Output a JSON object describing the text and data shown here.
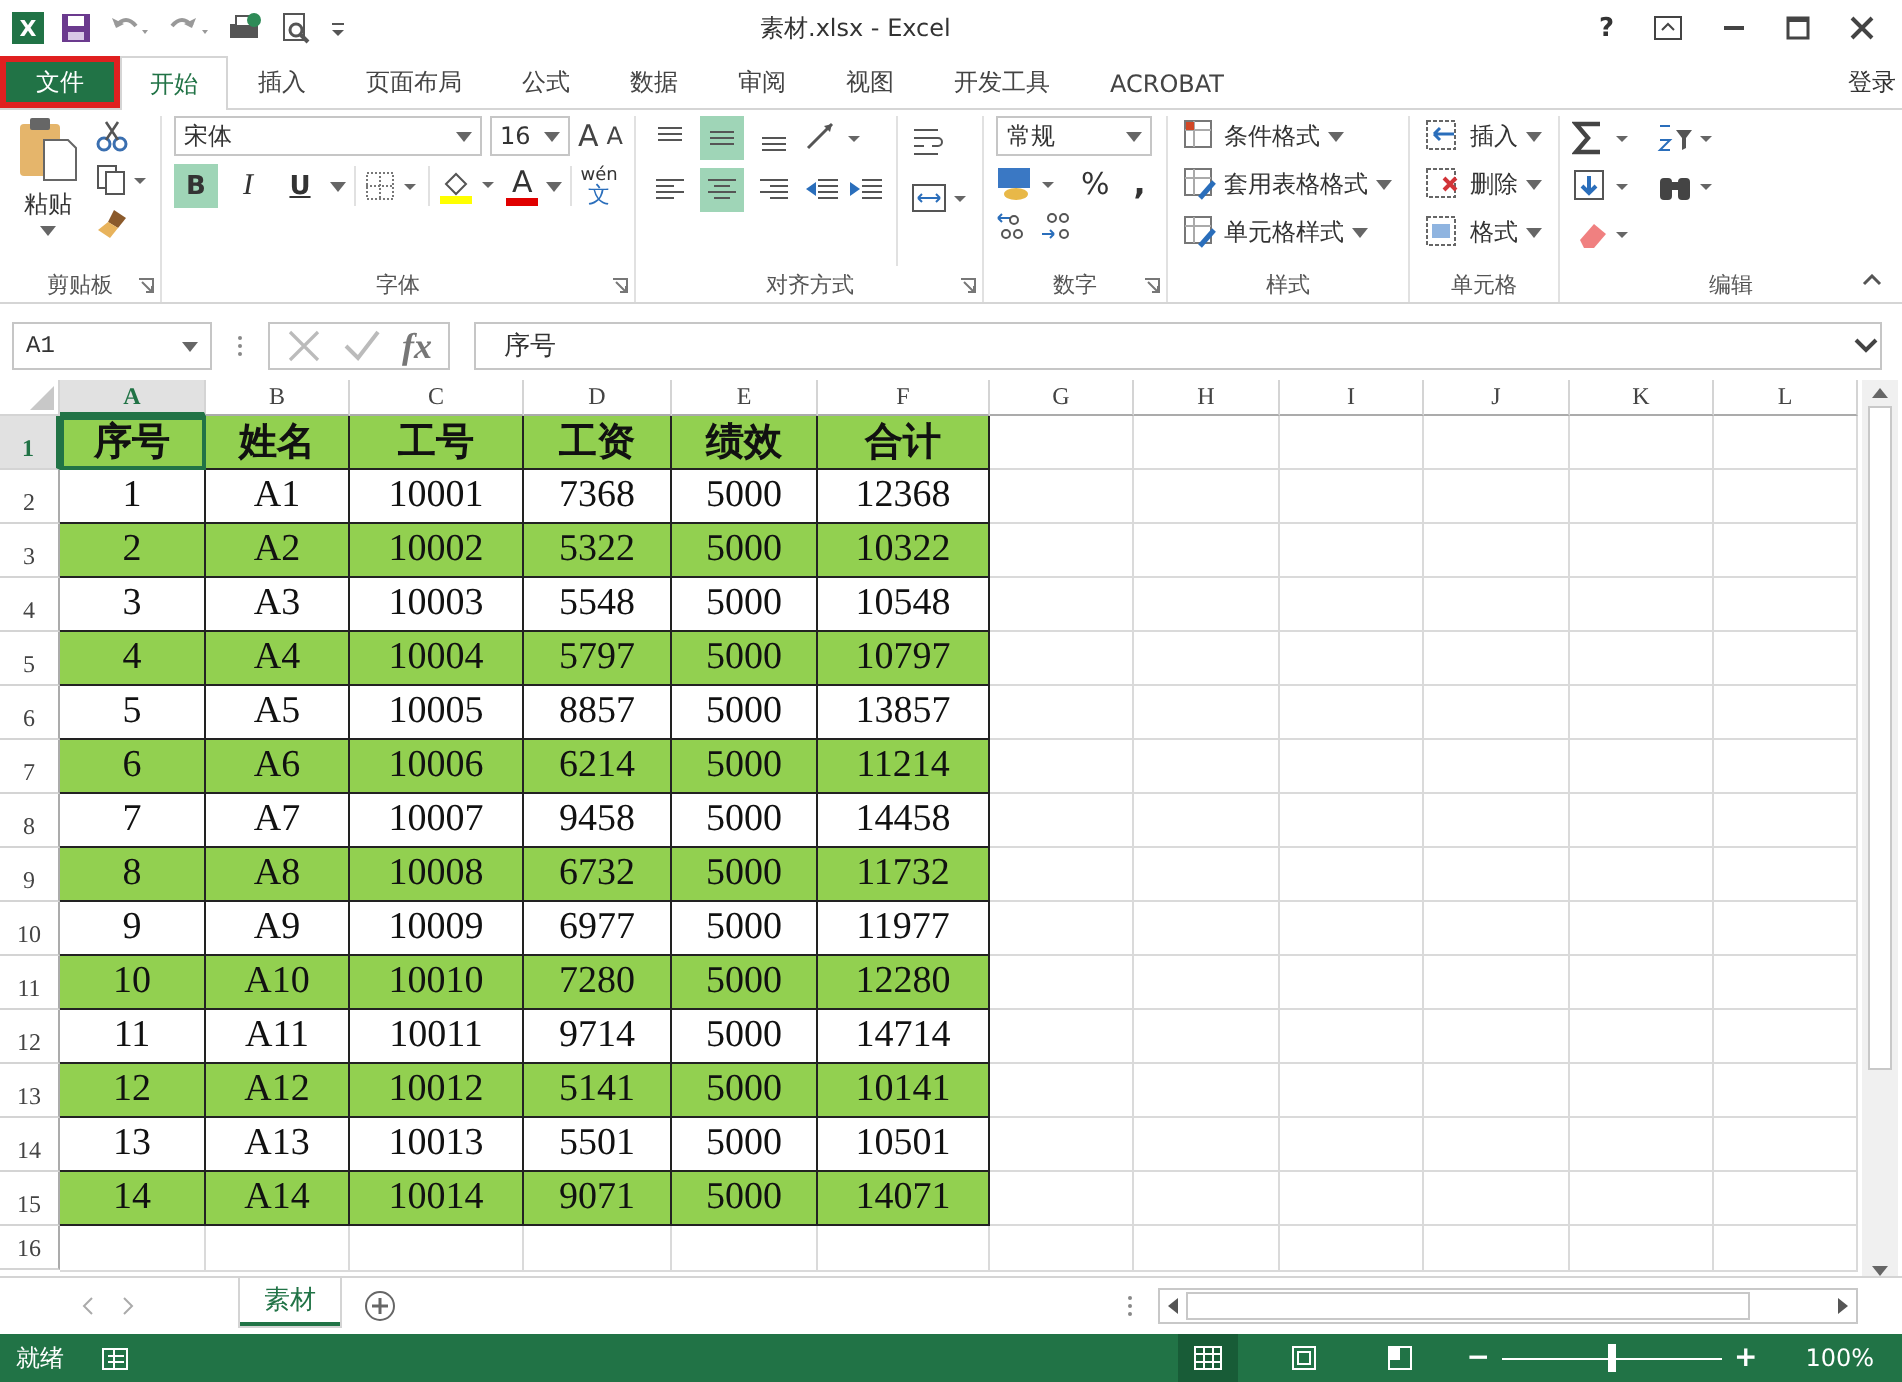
{
  "title_bar": {
    "app_icon": "X",
    "title": "素材.xlsx - Excel",
    "help": "?"
  },
  "menu_tabs": [
    {
      "label": "文件",
      "kind": "file",
      "selected": false,
      "annotated": true
    },
    {
      "label": "开始",
      "kind": "tab",
      "selected": true
    },
    {
      "label": "插入",
      "kind": "tab",
      "selected": false
    },
    {
      "label": "页面布局",
      "kind": "tab",
      "selected": false
    },
    {
      "label": "公式",
      "kind": "tab",
      "selected": false
    },
    {
      "label": "数据",
      "kind": "tab",
      "selected": false
    },
    {
      "label": "审阅",
      "kind": "tab",
      "selected": false
    },
    {
      "label": "视图",
      "kind": "tab",
      "selected": false
    },
    {
      "label": "开发工具",
      "kind": "tab",
      "selected": false
    },
    {
      "label": "ACROBAT",
      "kind": "tab",
      "selected": false
    }
  ],
  "account": "登录",
  "ribbon": {
    "clipboard": {
      "paste": "粘贴",
      "label": "剪贴板"
    },
    "font": {
      "name": "宋体",
      "size": "16",
      "grow": "A",
      "shrink": "A",
      "label": "字体",
      "phonetic_top": "wén",
      "phonetic_bottom": "文",
      "font_color": "A",
      "styles": [
        {
          "text": "B",
          "kind": "bold",
          "on": true
        },
        {
          "text": "I",
          "kind": "italic",
          "on": false
        },
        {
          "text": "U",
          "kind": "underline",
          "on": false
        }
      ]
    },
    "alignment": {
      "label": "对齐方式",
      "vertical": [
        {
          "kind": "top",
          "on": false
        },
        {
          "kind": "middle",
          "on": true
        },
        {
          "kind": "bottom",
          "on": false
        }
      ],
      "horizontal": [
        {
          "kind": "left",
          "on": false
        },
        {
          "kind": "center",
          "on": true
        },
        {
          "kind": "right",
          "on": false
        }
      ]
    },
    "number": {
      "format": "常规",
      "percent": "%",
      "comma": ",",
      "label": "数字"
    },
    "styles": {
      "items": [
        "条件格式",
        "套用表格格式",
        "单元格样式"
      ],
      "label": "样式"
    },
    "cells": {
      "items": [
        "插入",
        "删除",
        "格式"
      ],
      "label": "单元格"
    },
    "editing": {
      "label": "编辑"
    }
  },
  "formula_bar": {
    "name_box": "A1",
    "fx": "fx",
    "value": "序号"
  },
  "sheet": {
    "columns": [
      {
        "label": "A",
        "selected": true
      },
      {
        "label": "B",
        "selected": false
      },
      {
        "label": "C",
        "selected": false
      },
      {
        "label": "D",
        "selected": false
      },
      {
        "label": "E",
        "selected": false
      },
      {
        "label": "F",
        "selected": false
      },
      {
        "label": "G",
        "selected": false
      },
      {
        "label": "H",
        "selected": false
      },
      {
        "label": "I",
        "selected": false
      },
      {
        "label": "J",
        "selected": false
      },
      {
        "label": "K",
        "selected": false
      },
      {
        "label": "L",
        "selected": false
      }
    ],
    "rows": [
      {
        "header": "1",
        "selected": true,
        "kind": "header",
        "shaded": true,
        "cells": [
          "序号",
          "姓名",
          "工号",
          "工资",
          "绩效",
          "合计"
        ]
      },
      {
        "header": "2",
        "selected": false,
        "kind": "data",
        "shaded": false,
        "cells": [
          "1",
          "A1",
          "10001",
          "7368",
          "5000",
          "12368"
        ]
      },
      {
        "header": "3",
        "selected": false,
        "kind": "data",
        "shaded": true,
        "cells": [
          "2",
          "A2",
          "10002",
          "5322",
          "5000",
          "10322"
        ]
      },
      {
        "header": "4",
        "selected": false,
        "kind": "data",
        "shaded": false,
        "cells": [
          "3",
          "A3",
          "10003",
          "5548",
          "5000",
          "10548"
        ]
      },
      {
        "header": "5",
        "selected": false,
        "kind": "data",
        "shaded": true,
        "cells": [
          "4",
          "A4",
          "10004",
          "5797",
          "5000",
          "10797"
        ]
      },
      {
        "header": "6",
        "selected": false,
        "kind": "data",
        "shaded": false,
        "cells": [
          "5",
          "A5",
          "10005",
          "8857",
          "5000",
          "13857"
        ]
      },
      {
        "header": "7",
        "selected": false,
        "kind": "data",
        "shaded": true,
        "cells": [
          "6",
          "A6",
          "10006",
          "6214",
          "5000",
          "11214"
        ]
      },
      {
        "header": "8",
        "selected": false,
        "kind": "data",
        "shaded": false,
        "cells": [
          "7",
          "A7",
          "10007",
          "9458",
          "5000",
          "14458"
        ]
      },
      {
        "header": "9",
        "selected": false,
        "kind": "data",
        "shaded": true,
        "cells": [
          "8",
          "A8",
          "10008",
          "6732",
          "5000",
          "11732"
        ]
      },
      {
        "header": "10",
        "selected": false,
        "kind": "data",
        "shaded": false,
        "cells": [
          "9",
          "A9",
          "10009",
          "6977",
          "5000",
          "11977"
        ]
      },
      {
        "header": "11",
        "selected": false,
        "kind": "data",
        "shaded": true,
        "cells": [
          "10",
          "A10",
          "10010",
          "7280",
          "5000",
          "12280"
        ]
      },
      {
        "header": "12",
        "selected": false,
        "kind": "data",
        "shaded": false,
        "cells": [
          "11",
          "A11",
          "10011",
          "9714",
          "5000",
          "14714"
        ]
      },
      {
        "header": "13",
        "selected": false,
        "kind": "data",
        "shaded": true,
        "cells": [
          "12",
          "A12",
          "10012",
          "5141",
          "5000",
          "10141"
        ]
      },
      {
        "header": "14",
        "selected": false,
        "kind": "data",
        "shaded": false,
        "cells": [
          "13",
          "A13",
          "10013",
          "5501",
          "5000",
          "10501"
        ]
      },
      {
        "header": "15",
        "selected": false,
        "kind": "data",
        "shaded": true,
        "cells": [
          "14",
          "A14",
          "10014",
          "9071",
          "5000",
          "14071"
        ]
      },
      {
        "header": "16",
        "selected": false,
        "cells": []
      }
    ]
  },
  "sheet_tabs": [
    {
      "label": "素材",
      "selected": true
    }
  ],
  "status_bar": {
    "status": "就绪",
    "views": [
      {
        "kind": "normal",
        "selected": true
      },
      {
        "kind": "page_layout",
        "selected": false
      },
      {
        "kind": "page_break",
        "selected": false
      }
    ],
    "zoom_out": "−",
    "zoom": {
      "level": 0.5
    },
    "zoom_in": "+",
    "zoom_percent": "100%"
  }
}
